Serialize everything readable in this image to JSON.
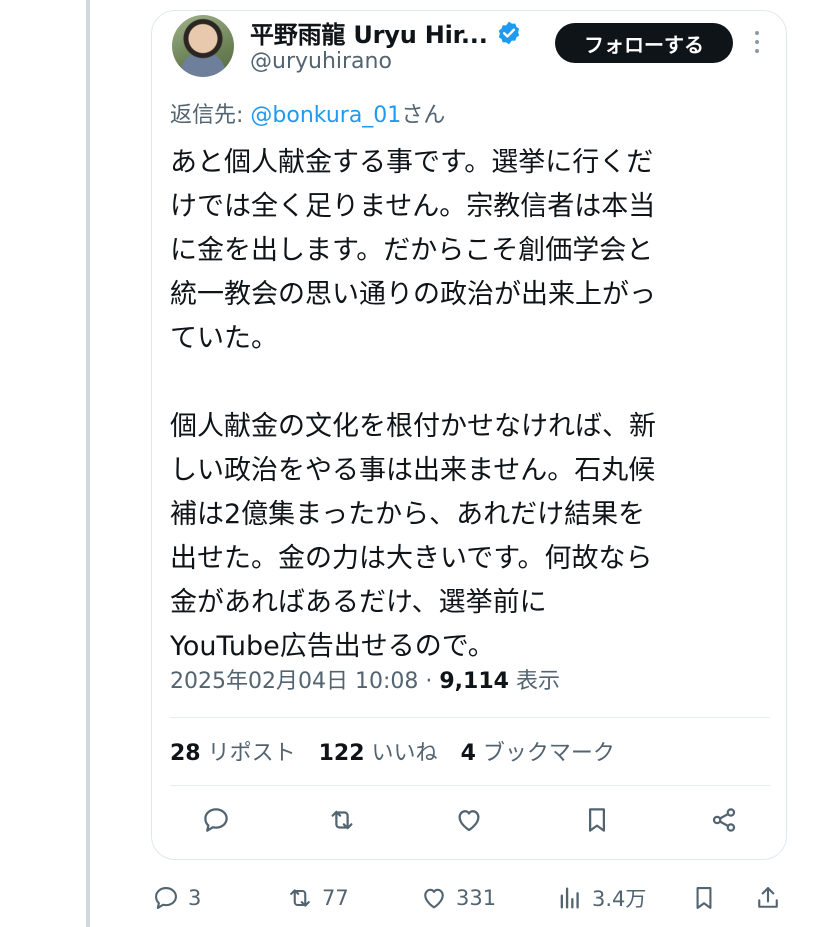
{
  "tweet": {
    "author_name": "平野雨龍 Uryu Hir...",
    "handle": "@uryuhirano",
    "follow_label": "フォローする",
    "reply_prefix": "返信先: ",
    "reply_mention": "@bonkura_01",
    "reply_suffix": "さん",
    "body_lines": [
      "あと個人献金する事です。選挙に行くだ",
      "けでは全く足りません。宗教信者は本当",
      "に金を出します。だからこそ創価学会と",
      "統一教会の思い通りの政治が出来上がっ",
      "ていた。",
      "",
      "個人献金の文化を根付かせなければ、新",
      "しい政治をやる事は出来ません。石丸候",
      "補は2億集まったから、あれだけ結果を",
      "出せた。金の力は大きいです。何故なら",
      "金があればあるだけ、選挙前に",
      "YouTube広告出せるので。"
    ],
    "timestamp": "2025年02月04日 10:08",
    "separator": " · ",
    "views_count": "9,114",
    "views_label": " 表示",
    "reposts_count": "28",
    "reposts_label": " リポスト",
    "likes_count": "122",
    "likes_label": " いいね",
    "bookmarks_count": "4",
    "bookmarks_label": " ブックマーク"
  },
  "bottom_bar": {
    "replies": "3",
    "reposts": "77",
    "likes": "331",
    "views": "3.4万"
  },
  "icons": {
    "verified": "verified-badge-icon",
    "more": "more-dots-icon",
    "reply": "comment-icon",
    "repost": "repost-icon",
    "like": "heart-icon",
    "bookmark": "bookmark-icon",
    "share": "share-icon",
    "views": "bar-chart-icon",
    "upload": "upload-icon"
  },
  "colors": {
    "accent": "#1d9bf0",
    "text": "#0f1419",
    "secondary": "#536471",
    "follow_bg": "#0f1419"
  }
}
